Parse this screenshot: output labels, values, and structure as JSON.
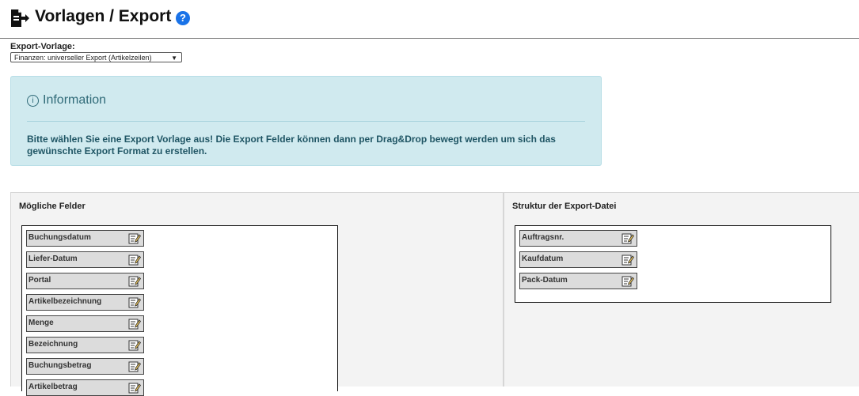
{
  "header": {
    "title": "Vorlagen / Export",
    "help": "?"
  },
  "export": {
    "label": "Export-Vorlage:",
    "selected": "Finanzen: universeller Export (Artikelzeilen)",
    "arrow": "▼"
  },
  "info": {
    "icon": "i",
    "heading": "Information",
    "message": "Bitte wählen Sie eine Export Vorlage aus! Die Export Felder können dann per Drag&Drop bewegt werden um sich das gewünschte Export Format zu erstellen."
  },
  "left_panel": {
    "title": "Mögliche Felder",
    "fields": [
      {
        "label": "Buchungsdatum"
      },
      {
        "label": "Liefer-Datum"
      },
      {
        "label": "Portal"
      },
      {
        "label": "Artikelbezeichnung"
      },
      {
        "label": "Menge"
      },
      {
        "label": "Bezeichnung"
      },
      {
        "label": "Buchungsbetrag"
      },
      {
        "label": "Artikelbetrag"
      }
    ]
  },
  "right_panel": {
    "title": "Struktur der Export-Datei",
    "fields": [
      {
        "label": "Auftragsnr."
      },
      {
        "label": "Kaufdatum"
      },
      {
        "label": "Pack-Datum"
      }
    ]
  },
  "icons": {
    "page": "export-document-icon",
    "help": "help-icon",
    "edit": "edit-icon",
    "info": "info-icon"
  },
  "colors": {
    "help": "#1a73e8",
    "info_bg": "#d0eaef",
    "info_text": "#1f5564",
    "field_bg": "#dcdcdc",
    "panel_bg": "#f3f3f3"
  }
}
